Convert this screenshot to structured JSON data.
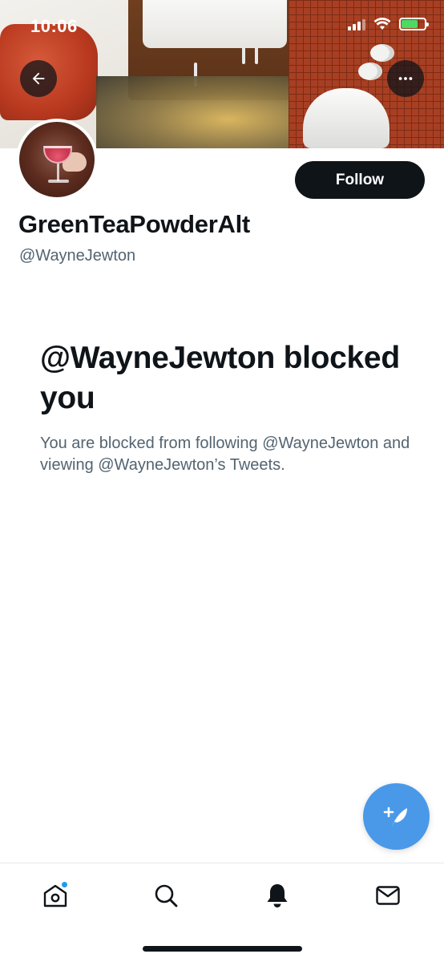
{
  "status_bar": {
    "time": "10:06"
  },
  "header": {
    "back_icon": "arrow-left-icon",
    "more_icon": "more-horizontal-icon"
  },
  "profile": {
    "display_name": "GreenTeaPowderAlt",
    "handle": "@WayneJewton",
    "follow_label": "Follow"
  },
  "blocked": {
    "title": "@WayneJewton blocked you",
    "description": "You are blocked from following @WayneJewton and viewing @WayneJewton’s Tweets."
  },
  "compose_fab": {
    "icon": "compose-feather-icon",
    "color": "#4a99e9"
  },
  "bottom_nav": {
    "items": [
      {
        "name": "home",
        "icon": "home-icon",
        "has_badge": true
      },
      {
        "name": "search",
        "icon": "search-icon"
      },
      {
        "name": "notifications",
        "icon": "bell-icon",
        "active": true
      },
      {
        "name": "messages",
        "icon": "mail-icon"
      }
    ]
  },
  "colors": {
    "accent": "#1d9bf0",
    "text_primary": "#0f1419",
    "text_secondary": "#536471"
  }
}
